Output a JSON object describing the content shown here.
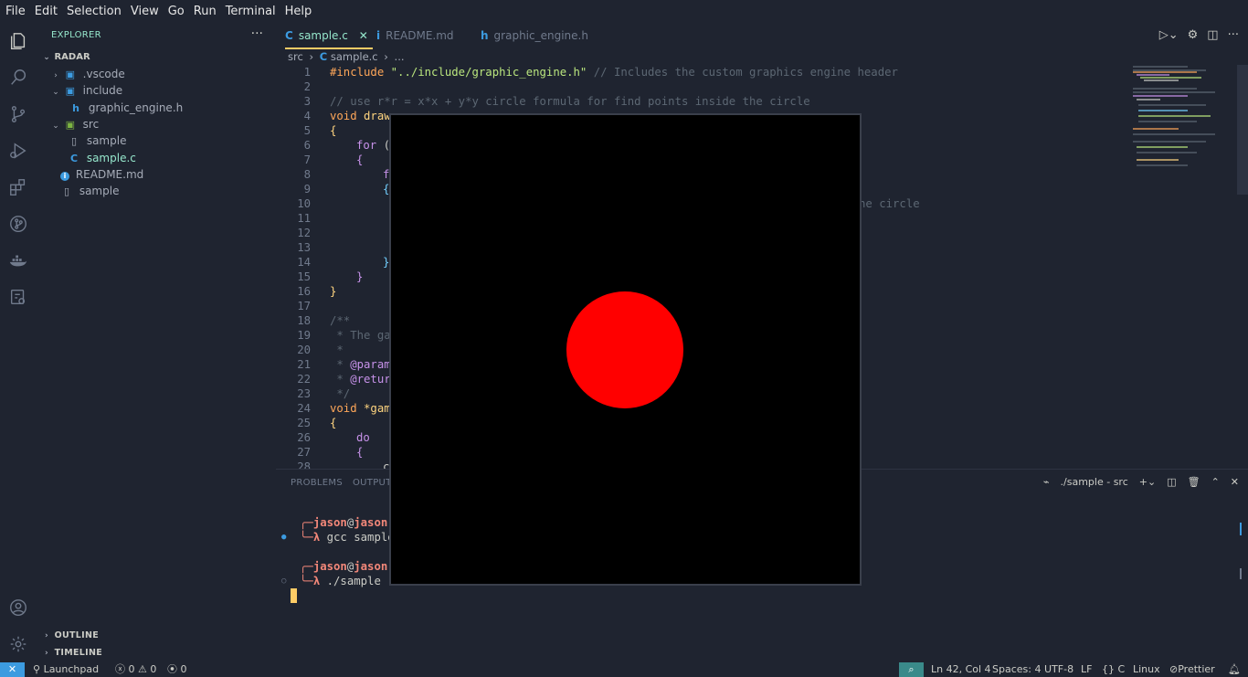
{
  "menu": [
    "File",
    "Edit",
    "Selection",
    "View",
    "Go",
    "Run",
    "Terminal",
    "Help"
  ],
  "activity_bar": {
    "top": [
      "explorer-icon",
      "search-icon",
      "source-control-icon",
      "run-debug-icon",
      "extensions-icon",
      "git-graph-icon",
      "docker-icon",
      "remote-explorer-icon"
    ],
    "bottom": [
      "account-icon",
      "settings-gear-icon"
    ]
  },
  "sidebar": {
    "title": "EXPLORER",
    "more": "···",
    "root": "RADAR",
    "items": [
      {
        "label": ".vscode",
        "type": "folder",
        "chev": "›"
      },
      {
        "label": "include",
        "type": "folder",
        "chev": "⌄"
      },
      {
        "label": "graphic_engine.h",
        "type": "h",
        "icon": "h"
      },
      {
        "label": "src",
        "type": "folder",
        "chev": "⌄"
      },
      {
        "label": "sample",
        "type": "file"
      },
      {
        "label": "sample.c",
        "type": "c",
        "icon": "C"
      },
      {
        "label": "README.md",
        "type": "md",
        "icon": "i"
      },
      {
        "label": "sample",
        "type": "file"
      }
    ],
    "outline": "OUTLINE",
    "timeline": "TIMELINE"
  },
  "tabs": [
    {
      "label": "sample.c",
      "icon": "C",
      "close": "✕"
    },
    {
      "label": "README.md",
      "icon": "i"
    },
    {
      "label": "graphic_engine.h",
      "icon": "h"
    }
  ],
  "breadcrumb": {
    "folder": "src",
    "file": "sample.c",
    "rest": "..."
  },
  "editor": {
    "line_numbers": [
      "1",
      "2",
      "3",
      "4",
      "5",
      "6",
      "7",
      "8",
      "9",
      "10",
      "11",
      "12",
      "13",
      "14",
      "15",
      "16",
      "17",
      "18",
      "19",
      "20",
      "21",
      "22",
      "23",
      "24",
      "25",
      "26",
      "27",
      "28"
    ],
    "code": {
      "l1_kw": "#include",
      "l1_str": "\"../include/graphic_engine.h\"",
      "l1_com": "// Includes the custom graphics engine header",
      "l3": "// use r*r = x*x + y*y circle formula for find points inside the circle",
      "l4_kw": "void",
      "l4_fn": "draw",
      "l5": "{",
      "l6_kw": "for",
      "l6_rest": " (",
      "l7": "{",
      "l8": "f",
      "l9": "{",
      "l10_tail": "he circle",
      "l14": "}",
      "l15": "}",
      "l16": "}",
      "l18": "/**",
      "l19": " * The ga",
      "l20": " *",
      "l21_star": " * ",
      "l21_tag": "@param",
      "l22_star": " * ",
      "l22_tag": "@retur",
      "l23": " */",
      "l24_kw": "void",
      "l24_rest": " *gam",
      "l25": "{",
      "l26": "do",
      "l27": "{",
      "l28": "c"
    }
  },
  "panel": {
    "tabs": [
      "PROBLEMS",
      "OUTPUT"
    ],
    "terminal_name": "./sample - src",
    "lines": {
      "p1_user": "jason",
      "p1_at": "@",
      "p1_host": "jason",
      "p1_prompt": "λ",
      "p1_cmd": " gcc sample",
      "p2_user": "jason",
      "p2_at": "@",
      "p2_host": "jason",
      "p2_prompt": "λ",
      "p2_cmd": " ./sample"
    }
  },
  "status": {
    "remote": "✕",
    "launchpad": "Launchpad",
    "errors": "0",
    "warnings": "0",
    "ports": "0",
    "position": "Ln 42, Col 4",
    "spaces": "Spaces: 4",
    "encoding": "UTF-8",
    "eol": "LF",
    "language": "C",
    "os": "Linux",
    "prettier": "Prettier"
  },
  "colors": {
    "background": "#1f2430",
    "accent": "#95e6cb",
    "overlay_bg": "#000000",
    "circle": "#ff0000"
  }
}
